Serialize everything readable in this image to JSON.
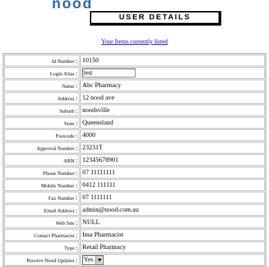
{
  "brand": {
    "logo_text": "nood"
  },
  "header": {
    "title": "USER DETAILS"
  },
  "links": {
    "items_listed": "Your Items currently listed"
  },
  "fields": [
    {
      "label": "Id Number",
      "value": "10150",
      "type": "text"
    },
    {
      "label": "Login Alias",
      "value": "test",
      "type": "input"
    },
    {
      "label": "Name",
      "value": "Abc Pharmacy",
      "type": "text"
    },
    {
      "label": "Address",
      "value": "12 nood ave",
      "type": "text"
    },
    {
      "label": "Suburb",
      "value": "noodsville",
      "type": "text"
    },
    {
      "label": "State",
      "value": "Queensland",
      "type": "text"
    },
    {
      "label": "Postcode",
      "value": "4000",
      "type": "text"
    },
    {
      "label": "Approval Number",
      "value": "23231T",
      "type": "text"
    },
    {
      "label": "ABN",
      "value": "12345678901",
      "type": "text"
    },
    {
      "label": "Phone Number",
      "value": "07 11111111",
      "type": "text"
    },
    {
      "label": "Mobile Number",
      "value": "0412 111111",
      "type": "text"
    },
    {
      "label": "Fax Number",
      "value": "07 1111111",
      "type": "text"
    },
    {
      "label": "Email Address",
      "value": "admin@nood.com.au",
      "type": "text"
    },
    {
      "label": "Web Site",
      "value": "NULL",
      "type": "text"
    },
    {
      "label": "Contact Pharmacist",
      "value": "Ima Pharmacist",
      "type": "text"
    },
    {
      "label": "Type",
      "value": "Retail Pharmacy",
      "type": "text"
    },
    {
      "label": "Receive Nood Updates",
      "value": "Yes",
      "type": "select"
    }
  ],
  "separator": ":",
  "colors": {
    "logo": "#2f6aa8",
    "link": "#0000ee"
  }
}
